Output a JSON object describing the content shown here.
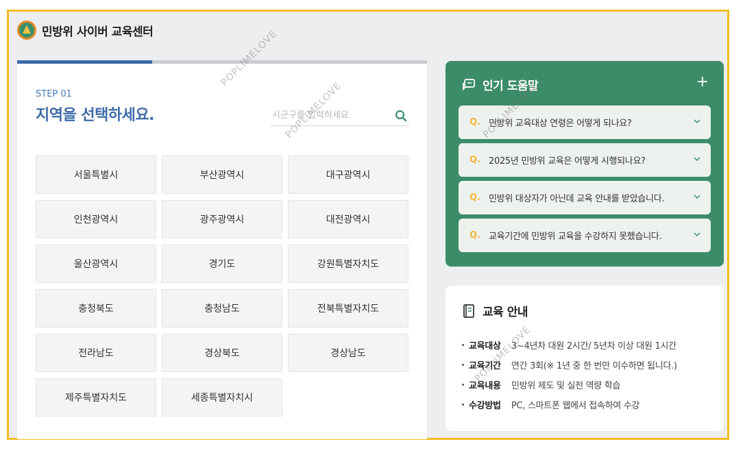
{
  "header": {
    "logo_icon": "civil-defense-logo-icon",
    "title": "민방위 사이버 교육센터"
  },
  "step": {
    "label": "STEP 01",
    "title": "지역을 선택하세요.",
    "progress_fraction": 0.33,
    "progress_color": "#3e6aa8"
  },
  "search": {
    "placeholder": "시군구를 입력하세요",
    "value": "",
    "icon": "search-icon"
  },
  "regions": [
    "서울특별시",
    "부산광역시",
    "대구광역시",
    "인천광역시",
    "광주광역시",
    "대전광역시",
    "울산광역시",
    "경기도",
    "강원특별자치도",
    "충청북도",
    "충청남도",
    "전북특별자치도",
    "전라남도",
    "경상북도",
    "경상남도",
    "제주특별자치도",
    "세종특별자치시"
  ],
  "faq": {
    "title": "인기 도움말",
    "icon": "chat-bubble-icon",
    "expand_icon": "plus-icon",
    "q_label": "Q.",
    "items": [
      "민방위 교육대상 연령은 어떻게 되나요?",
      "2025년 민방위 교육은 어떻게 시행되나요?",
      "민방위 대상자가 아닌데 교육 안내를 받았습니다.",
      "교육기간에 민방위 교육을 수강하지 못했습니다."
    ],
    "panel_color": "#3d8c69"
  },
  "edu": {
    "title": "교육 안내",
    "icon": "book-icon",
    "rows": [
      {
        "key": "교육대상",
        "value": "3~4년차 대원 2시간/ 5년차 이상 대원 1시간"
      },
      {
        "key": "교육기간",
        "value": "연간 3회(※ 1년 중 한 번만 이수하면 됩니다.)"
      },
      {
        "key": "교육내용",
        "value": "민방위 제도 및 실전 역량 학습"
      },
      {
        "key": "수강방법",
        "value": "PC, 스마트폰 웹에서 접속하여 수강"
      }
    ]
  },
  "watermark": "POPLIMELOVE"
}
